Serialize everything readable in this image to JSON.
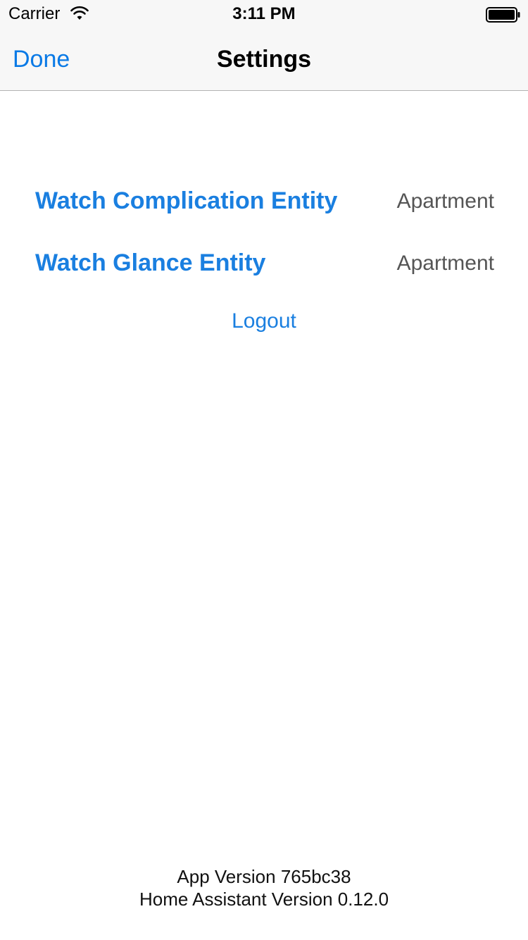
{
  "status_bar": {
    "carrier": "Carrier",
    "time": "3:11 PM",
    "wifi_icon": "wifi-icon",
    "battery_icon": "battery-full-icon"
  },
  "nav": {
    "back_label": "Done",
    "title": "Settings"
  },
  "settings": {
    "rows": [
      {
        "label": "Watch Complication Entity",
        "value": "Apartment"
      },
      {
        "label": "Watch Glance Entity",
        "value": "Apartment"
      }
    ],
    "logout_label": "Logout"
  },
  "footer": {
    "app_version": "App Version 765bc38",
    "ha_version": "Home Assistant Version 0.12.0"
  },
  "colors": {
    "accent": "#1a7fe0",
    "value_text": "#555555",
    "bar_background": "#f7f7f7"
  }
}
